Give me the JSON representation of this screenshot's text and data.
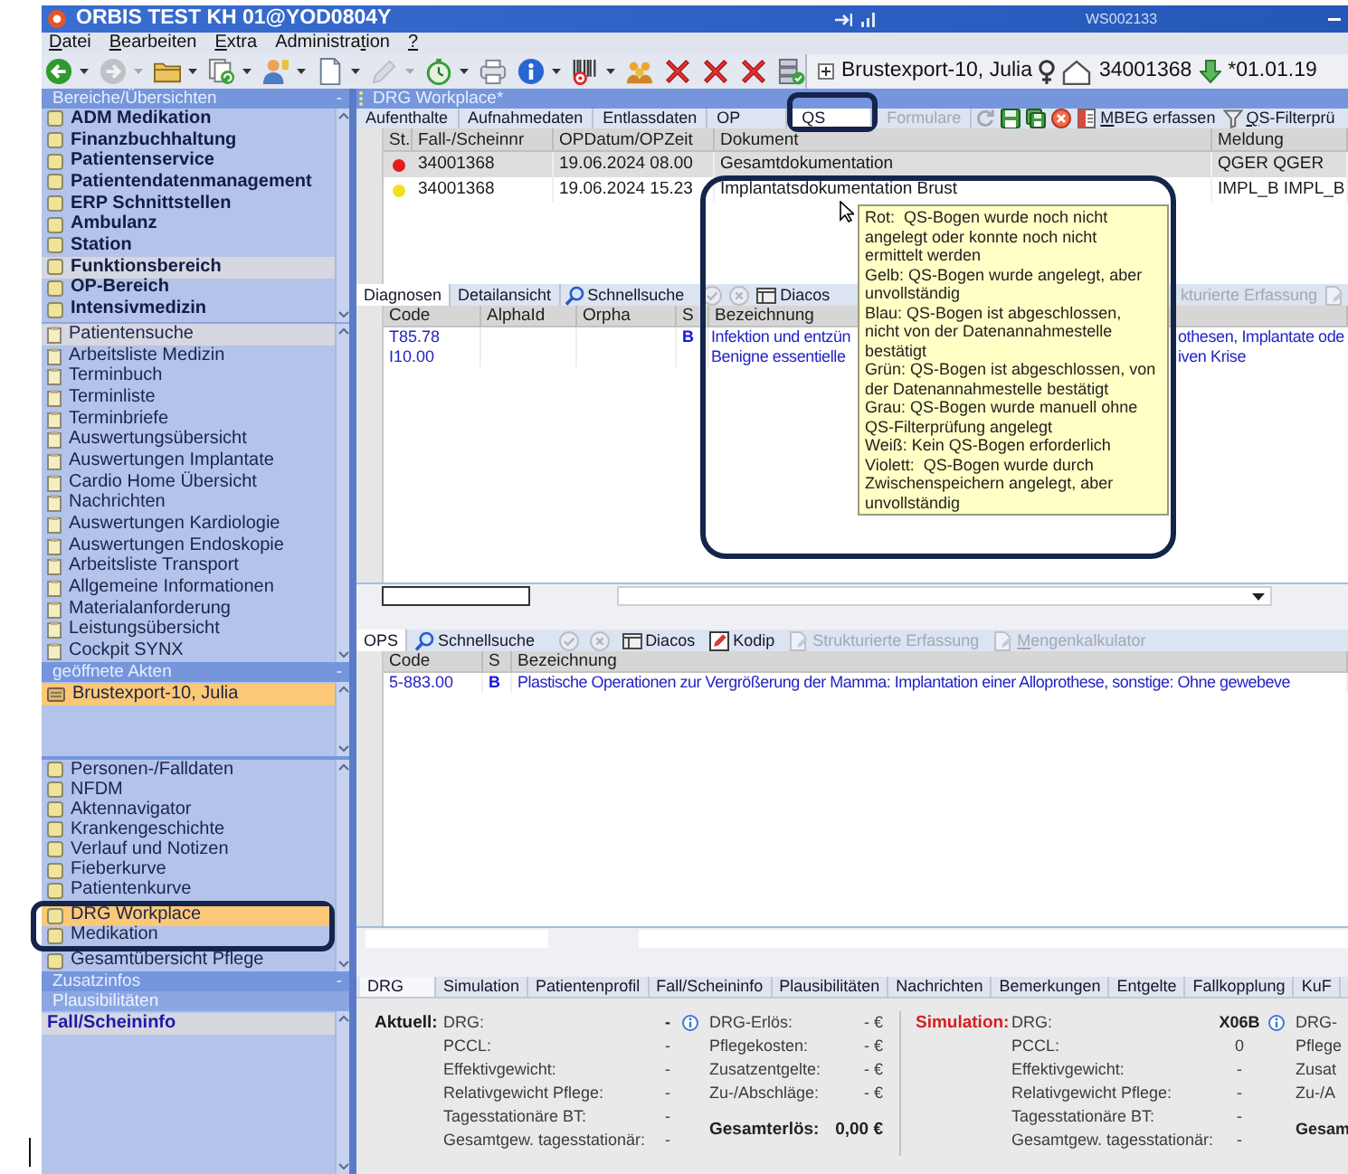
{
  "window": {
    "title": "ORBIS TEST KH 01@YOD0804Y",
    "workstation": "WS002133"
  },
  "menu": [
    {
      "label": {
        "key": "D",
        "rest": "atei"
      }
    },
    {
      "label": {
        "key": "B",
        "rest": "earbeiten"
      }
    },
    {
      "label": {
        "key": "E",
        "rest": "xtra"
      }
    },
    {
      "label": {
        "before": "Administra",
        "key": "t",
        "rest": "ion"
      }
    },
    {
      "label": {
        "key": "?"
      }
    }
  ],
  "toolbar": [
    {
      "kind": "back",
      "disabled": false,
      "dropdown": true
    },
    {
      "kind": "forward",
      "disabled": true,
      "dropdown": true
    },
    {
      "kind": "folder",
      "disabled": false,
      "dropdown": true
    },
    {
      "kind": "documents",
      "disabled": false,
      "dropdown": true
    },
    {
      "kind": "person",
      "disabled": false,
      "dropdown": true
    },
    {
      "kind": "document",
      "disabled": false,
      "dropdown": true
    },
    {
      "kind": "pencil",
      "disabled": true,
      "dropdown": true
    },
    {
      "kind": "stopwatch",
      "disabled": false,
      "dropdown": true
    },
    {
      "kind": "printer",
      "disabled": false,
      "dropdown": false
    },
    {
      "kind": "info",
      "disabled": false,
      "dropdown": true
    },
    {
      "kind": "barcode",
      "disabled": false,
      "dropdown": true
    },
    {
      "kind": "people",
      "disabled": false,
      "dropdown": false
    },
    {
      "kind": "delete",
      "disabled": false,
      "dropdown": false
    },
    {
      "kind": "delete",
      "disabled": false,
      "dropdown": false
    },
    {
      "kind": "delete",
      "disabled": false,
      "dropdown": false
    },
    {
      "kind": "server",
      "disabled": false,
      "dropdown": false
    }
  ],
  "patient": {
    "name": "Brustexport-10, Julia",
    "case_number": "34001368",
    "birth_date": "*01.01.19"
  },
  "sidebar": {
    "areas": {
      "title": "Bereiche/Übersichten",
      "collapse": "-",
      "items": [
        {
          "label": "ADM Medikation",
          "selected": false
        },
        {
          "label": "Finanzbuchhaltung",
          "selected": false
        },
        {
          "label": "Patientenservice",
          "selected": false
        },
        {
          "label": "Patientendatenmanagement",
          "selected": false
        },
        {
          "label": "ERP Schnittstellen",
          "selected": false
        },
        {
          "label": "Ambulanz",
          "selected": false
        },
        {
          "label": "Station",
          "selected": false
        },
        {
          "label": "Funktionsbereich",
          "selected": true
        },
        {
          "label": "OP-Bereich",
          "selected": false
        },
        {
          "label": "Intensivmedizin",
          "selected": false
        }
      ]
    },
    "overviews": [
      {
        "label": "Patientensuche",
        "selected": true
      },
      {
        "label": "Arbeitsliste Medizin",
        "selected": false
      },
      {
        "label": "Terminbuch",
        "selected": false
      },
      {
        "label": "Terminliste",
        "selected": false
      },
      {
        "label": "Terminbriefe",
        "selected": false
      },
      {
        "label": "Auswertungsübersicht",
        "selected": false
      },
      {
        "label": "Auswertungen Implantate",
        "selected": false
      },
      {
        "label": "Cardio Home Übersicht",
        "selected": false
      },
      {
        "label": "Nachrichten",
        "selected": false
      },
      {
        "label": "Auswertungen Kardiologie",
        "selected": false
      },
      {
        "label": "Auswertungen Endoskopie",
        "selected": false
      },
      {
        "label": "Arbeitsliste Transport",
        "selected": false
      },
      {
        "label": "Allgemeine Informationen",
        "selected": false
      },
      {
        "label": "Materialanforderung",
        "selected": false
      },
      {
        "label": "Leistungsübersicht",
        "selected": false
      },
      {
        "label": "Cockpit SYNX",
        "selected": false
      }
    ],
    "open_records": {
      "title": "geöffnete Akten",
      "collapse": "-",
      "items": [
        {
          "label": "Brustexport-10, Julia",
          "selected": true
        }
      ]
    },
    "record_views": [
      {
        "label": "Personen-/Falldaten",
        "selected": false,
        "highlighted": false
      },
      {
        "label": "NFDM",
        "selected": false,
        "highlighted": false
      },
      {
        "label": "Aktennavigator",
        "selected": false,
        "highlighted": false
      },
      {
        "label": "Krankengeschichte",
        "selected": false,
        "highlighted": false
      },
      {
        "label": "Verlauf und Notizen",
        "selected": false,
        "highlighted": false
      },
      {
        "label": "Fieberkurve",
        "selected": false,
        "highlighted": false
      },
      {
        "label": "Patientenkurve",
        "selected": false,
        "highlighted": false
      },
      {
        "label": "DRG Workplace",
        "selected": true,
        "highlighted": true
      },
      {
        "label": "Medikation",
        "selected": false,
        "highlighted": true
      },
      {
        "label": "Gesamtübersicht Pflege",
        "selected": false,
        "highlighted": false
      }
    ],
    "extra_info": {
      "title": "Zusatzinfos",
      "collapse": "-",
      "subtitle": "Plausibilitäten",
      "items": [
        {
          "label": "Fall/Scheininfo",
          "selected": true
        }
      ]
    }
  },
  "workplace": {
    "title": "DRG Workplace*",
    "tabs": [
      {
        "label": "Aufenthalte",
        "selected": false,
        "disabled": false,
        "highlighted": false
      },
      {
        "label": "Aufnahmedaten",
        "selected": false,
        "disabled": false,
        "highlighted": false
      },
      {
        "label": "Entlassdaten",
        "selected": false,
        "disabled": false,
        "highlighted": false
      },
      {
        "label": "OP",
        "selected": false,
        "disabled": false,
        "highlighted": false
      },
      {
        "label": "QS",
        "selected": true,
        "disabled": false,
        "highlighted": true
      },
      {
        "label": "Formulare",
        "selected": false,
        "disabled": true,
        "highlighted": false
      }
    ],
    "tools": [
      {
        "kind": "refresh",
        "disabled": true
      },
      {
        "kind": "save",
        "disabled": false
      },
      {
        "kind": "save_all",
        "disabled": false
      },
      {
        "kind": "cancel",
        "disabled": false
      },
      {
        "kind": "form",
        "label": {
          "key": "M",
          "rest": "BEG erfassen"
        },
        "disabled": false
      },
      {
        "kind": "filter",
        "label": {
          "key": "Q",
          "rest": "S-Filterprü"
        },
        "disabled": false
      }
    ],
    "qs_table": {
      "columns": [
        "St.",
        "Fall-/Scheinnr",
        "OPDatum/OPZeit",
        "Dokument",
        "Meldung"
      ],
      "rows": [
        {
          "color": "#e41c1c",
          "case_number": "34001368",
          "op_time": "19.06.2024 08.00",
          "document": "Gesamtdokumentation",
          "report": "QGER QGER",
          "selected": true
        },
        {
          "color": "#f2e01e",
          "case_number": "34001368",
          "op_time": "19.06.2024 15.23",
          "document": "Implantatsdokumentation Brust",
          "report": "IMPL_B IMPL_B",
          "selected": false
        }
      ]
    },
    "tooltip": {
      "highlighted": true,
      "entries": [
        "Rot:  QS-Bogen wurde noch nicht\nangelegt oder konnte noch nicht\nermittelt werden",
        "Gelb: QS-Bogen wurde angelegt, aber\nunvollständig",
        "Blau: QS-Bogen ist abgeschlossen,\nnicht von der Datenannahmestelle\nbestätigt",
        "Grün: QS-Bogen ist abgeschlossen, von\nder Datenannahmestelle bestätigt",
        "Grau: QS-Bogen wurde manuell ohne\nQS-Filterprüfung angelegt",
        "Weiß: Kein QS-Bogen erforderlich",
        "Violett:  QS-Bogen wurde durch\nZwischenspeichern angelegt, aber\nunvollständig"
      ]
    },
    "diagnoses": {
      "tabs": [
        {
          "label": "Diagnosen",
          "selected": true
        },
        {
          "label": "Detailansicht",
          "selected": false
        }
      ],
      "tools": [
        {
          "kind": "search",
          "label": "Schnellsuche",
          "disabled": false
        },
        {
          "kind": "confirm",
          "disabled": true
        },
        {
          "kind": "discard",
          "disabled": true
        },
        {
          "kind": "diacos",
          "label": "Diacos",
          "disabled": false
        },
        {
          "kind": "plain",
          "label": "kturierte Erfassung",
          "disabled": true
        },
        {
          "kind": "calculator",
          "disabled": true
        }
      ],
      "columns": [
        "Code",
        "AlphaId",
        "Orpha",
        "S",
        "Bezeichnung"
      ],
      "rows": [
        {
          "code": "T85.78",
          "s": "B",
          "description": [
            "Infektion und entzün",
            "othesen, Implantate ode"
          ]
        },
        {
          "code": "I10.00",
          "description": [
            "Benigne essentielle",
            "iven Krise"
          ]
        }
      ]
    },
    "procedures": {
      "tabs": [
        {
          "label": "OPS",
          "selected": true
        }
      ],
      "tools": [
        {
          "kind": "search",
          "label": "Schnellsuche",
          "disabled": false
        },
        {
          "kind": "confirm",
          "disabled": true
        },
        {
          "kind": "discard",
          "disabled": true
        },
        {
          "kind": "diacos",
          "label": "Diacos",
          "disabled": false
        },
        {
          "kind": "kodip",
          "label": "Kodip",
          "disabled": false
        },
        {
          "kind": "structured",
          "label": "Strukturierte Erfassung",
          "disabled": true
        },
        {
          "kind": "calculator",
          "label": {
            "key": "M",
            "rest": "engenkalkulator"
          },
          "disabled": true
        }
      ],
      "columns": [
        "Code",
        "S",
        "Bezeichnung"
      ],
      "rows": [
        {
          "code": "5-883.00",
          "s": "B",
          "description": "Plastische Operationen zur Vergrößerung der Mamma: Implantation einer Alloprothese, sonstige: Ohne gewebeve"
        }
      ]
    }
  },
  "drg": {
    "tabs": [
      {
        "label": "DRG",
        "selected": true
      },
      {
        "label": "Simulation",
        "selected": false
      },
      {
        "label": "Patientenprofil",
        "selected": false
      },
      {
        "label": "Fall/Scheininfo",
        "selected": false
      },
      {
        "label": "Plausibilitäten",
        "selected": false
      },
      {
        "label": "Nachrichten",
        "selected": false
      },
      {
        "label": "Bemerkungen",
        "selected": false
      },
      {
        "label": "Entgelte",
        "selected": false
      },
      {
        "label": "Fallkopplung",
        "selected": false
      },
      {
        "label": "KuF",
        "selected": false
      }
    ],
    "current": {
      "heading": "Aktuell:",
      "fields": [
        {
          "label": "DRG:",
          "value": "-"
        },
        {
          "label": "PCCL:",
          "value": "-"
        },
        {
          "label": "Effektivgewicht:",
          "value": "-"
        },
        {
          "label": "Relativgewicht Pflege:",
          "value": "-"
        },
        {
          "label": "Tagesstationäre BT:",
          "value": "-"
        },
        {
          "label": "Gesamtgew. tagesstationär:",
          "value": "-"
        }
      ]
    },
    "current_revenue": {
      "fields": [
        {
          "label": "DRG-Erlös:",
          "value": "- €"
        },
        {
          "label": "Pflegekosten:",
          "value": "- €"
        },
        {
          "label": "Zusatzentgelte:",
          "value": "- €"
        },
        {
          "label": "Zu-/Abschläge:",
          "value": "- €"
        }
      ],
      "total": {
        "label": "Gesamterlös:",
        "value": "0,00 €"
      }
    },
    "simulation": {
      "heading": "Simulation:",
      "fields": [
        {
          "label": "DRG:",
          "value": "X06B"
        },
        {
          "label": "PCCL:",
          "value": "0"
        },
        {
          "label": "Effektivgewicht:",
          "value": "-"
        },
        {
          "label": "Relativgewicht Pflege:",
          "value": "-"
        },
        {
          "label": "Tagesstationäre BT:",
          "value": "-"
        },
        {
          "label": "Gesamtgew. tagesstationär:",
          "value": "-"
        }
      ]
    },
    "simulation_revenue": {
      "fields": [
        {
          "label": "DRG-"
        },
        {
          "label": "Pflege"
        },
        {
          "label": "Zusat"
        },
        {
          "label": "Zu-/A"
        }
      ],
      "total": {
        "label": "Gesam"
      }
    }
  }
}
